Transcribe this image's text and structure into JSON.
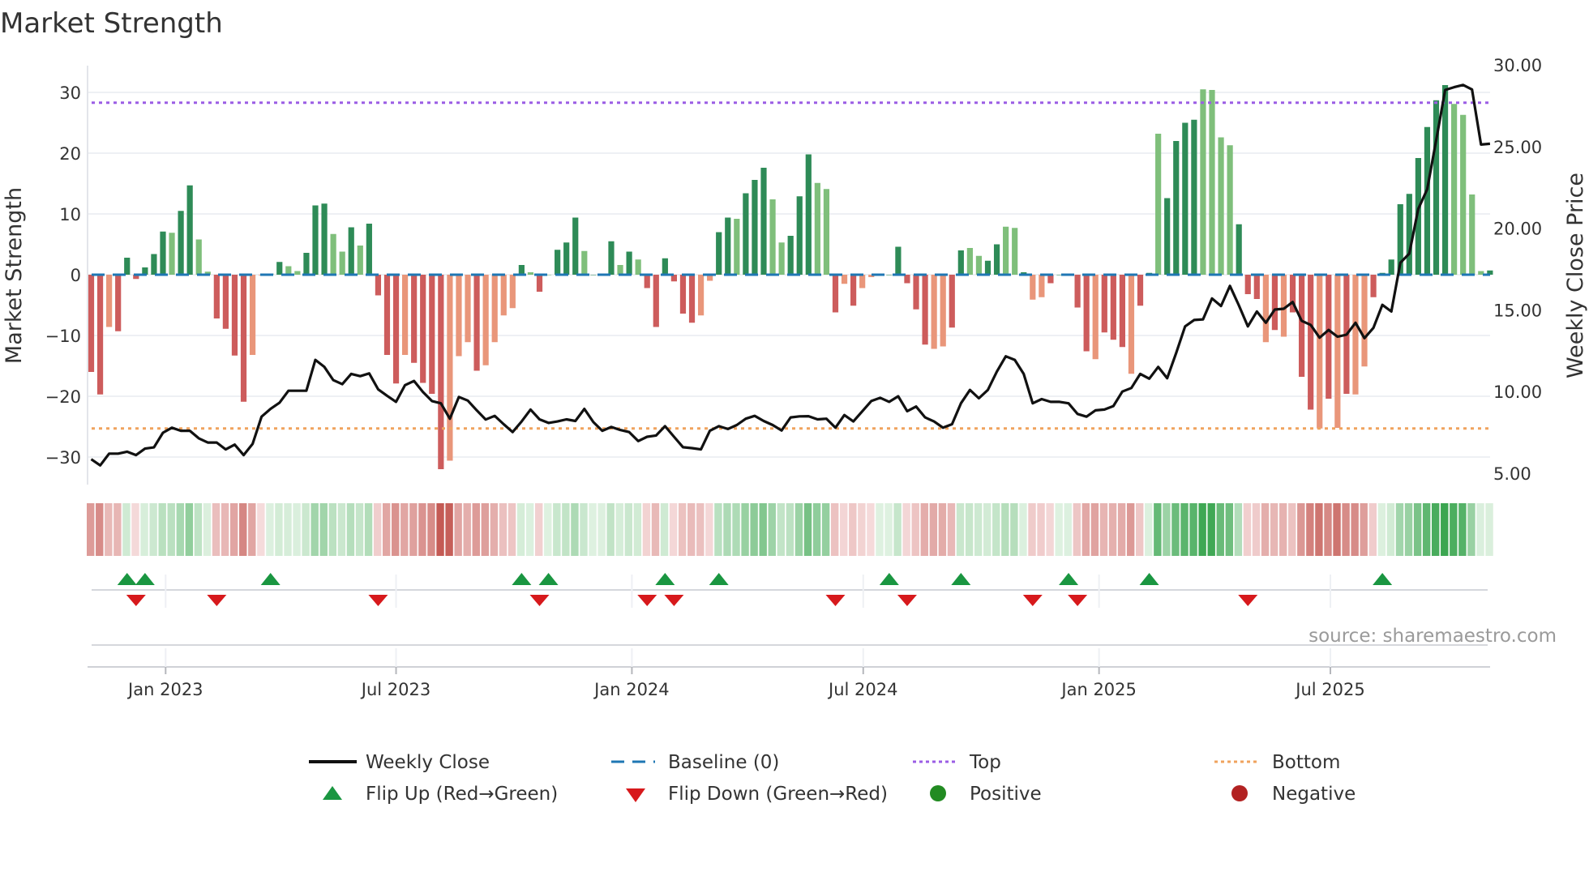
{
  "chart_data": {
    "type": "bar",
    "title": "Market Strength",
    "ylabel": "Market Strength",
    "y2label": "Weekly Close Price",
    "ylim": [
      -33,
      35
    ],
    "y2lim": [
      4.5,
      30.5
    ],
    "yticks": [
      30,
      20,
      10,
      0,
      -10,
      -20,
      -30
    ],
    "ytick_labels": [
      "30",
      "20",
      "10",
      "0",
      "−10",
      "−20",
      "−30"
    ],
    "y2ticks": [
      30,
      25,
      20,
      15,
      10,
      5
    ],
    "y2tick_labels": [
      "30.00",
      "25.00",
      "20.00",
      "15.00",
      "10.00",
      "5.00"
    ],
    "xticks": [
      {
        "label": "Jan 2023",
        "week": 9.3
      },
      {
        "label": "Jul 2023",
        "week": 35.0
      },
      {
        "label": "Jan 2024",
        "week": 61.3
      },
      {
        "label": "Jul 2024",
        "week": 87.1
      },
      {
        "label": "Jan 2025",
        "week": 113.4
      },
      {
        "label": "Jul 2025",
        "week": 139.2
      }
    ],
    "top_level": 28.3,
    "bottom_level": -25.3,
    "baseline": 0,
    "strength": [
      -16,
      -19.7,
      -8.6,
      -9.3,
      2.8,
      -0.7,
      1.2,
      3.4,
      7.1,
      6.9,
      10.5,
      14.7,
      5.8,
      0.5,
      -7.2,
      -8.9,
      -13.3,
      -20.9,
      -13.2,
      -0.1,
      0.2,
      2.1,
      1.4,
      0.6,
      3.6,
      11.4,
      11.7,
      6.7,
      3.8,
      7.8,
      4.8,
      8.4,
      -3.4,
      -13.2,
      -17.9,
      -13.2,
      -14.5,
      -17.8,
      -19.6,
      -32,
      -30.6,
      -13.4,
      -11.1,
      -15.8,
      -14.9,
      -11.1,
      -6.7,
      -5.5,
      1.6,
      0.4,
      -2.8,
      0,
      4.1,
      5.3,
      9.4,
      3.9,
      0,
      0.1,
      5.5,
      1.6,
      3.8,
      2.5,
      -2.2,
      -8.6,
      2.7,
      -1.1,
      -6.4,
      -7.9,
      -6.7,
      -1.0,
      7.0,
      9.4,
      9.2,
      13.4,
      15.6,
      17.6,
      12.4,
      5.3,
      6.4,
      12.9,
      19.8,
      15.1,
      14.1,
      -6.2,
      -1.5,
      -5.1,
      -2.2,
      -0.4,
      0,
      0,
      4.6,
      -1.4,
      -5.7,
      -11.5,
      -12.2,
      -11.8,
      -8.7,
      4.0,
      4.4,
      3.1,
      2.3,
      5.0,
      7.9,
      7.7,
      0.4,
      -4.1,
      -3.7,
      -1.4,
      0,
      0.2,
      -5.4,
      -12.6,
      -13.9,
      -9.5,
      -10.7,
      -11.9,
      -16.3,
      -5.1,
      0.3,
      23.2,
      12.6,
      22.0,
      25.0,
      25.5,
      30.5,
      30.4,
      22.6,
      21.3,
      8.3,
      -3.2,
      -4.0,
      -11.1,
      -9.1,
      -10.2,
      -6.2,
      -16.8,
      -22.2,
      -25.3,
      -20.4,
      -25.2,
      -19.6,
      -19.7,
      -15.1,
      -3.7,
      0.3,
      2.5,
      11.6,
      13.3,
      19.2,
      24.3,
      28.7,
      31.2,
      28.1,
      26.3,
      13.2,
      0.6,
      0.7
    ],
    "shade": "ddlddddddlddllddddllddlldddlldlddddldddd llldlllldldldddldldldlddddddllddldddllddd lldldllddddddllddllddlldlldddddldddlddlddddlllldddldldddldldlldddddddddlllld",
    "weekly_close": [
      5.86,
      5.48,
      6.2,
      6.2,
      6.32,
      6.11,
      6.51,
      6.58,
      7.48,
      7.79,
      7.6,
      7.6,
      7.14,
      6.88,
      6.88,
      6.46,
      6.75,
      6.11,
      6.8,
      8.46,
      8.94,
      9.32,
      10.05,
      10.05,
      10.05,
      11.94,
      11.51,
      10.7,
      10.45,
      11.08,
      10.94,
      11.11,
      10.14,
      9.74,
      9.37,
      10.39,
      10.65,
      9.97,
      9.42,
      9.28,
      8.34,
      9.67,
      9.45,
      8.85,
      8.29,
      8.51,
      8.0,
      7.52,
      8.17,
      8.9,
      8.3,
      8.08,
      8.17,
      8.3,
      8.2,
      8.94,
      8.13,
      7.6,
      7.83,
      7.65,
      7.52,
      6.97,
      7.23,
      7.31,
      7.88,
      7.23,
      6.59,
      6.54,
      6.46,
      7.6,
      7.88,
      7.71,
      7.95,
      8.34,
      8.51,
      8.2,
      7.95,
      7.62,
      8.42,
      8.48,
      8.49,
      8.3,
      8.34,
      7.79,
      8.56,
      8.17,
      8.8,
      9.42,
      9.62,
      9.37,
      9.71,
      8.8,
      9.08,
      8.42,
      8.17,
      7.79,
      8.0,
      9.28,
      10.1,
      9.59,
      10.1,
      11.22,
      12.16,
      11.94,
      11.08,
      9.28,
      9.54,
      9.37,
      9.37,
      9.28,
      8.63,
      8.46,
      8.85,
      8.9,
      9.11,
      10.0,
      10.22,
      11.08,
      10.79,
      11.51,
      10.82,
      12.36,
      13.99,
      14.38,
      14.42,
      15.7,
      15.24,
      16.47,
      15.27,
      13.99,
      14.9,
      14.21,
      15.02,
      15.07,
      15.48,
      14.33,
      14.08,
      13.3,
      13.77,
      13.36,
      13.48,
      14.21,
      13.27,
      13.9,
      15.31,
      14.9,
      17.88,
      18.44,
      21.18,
      22.38,
      25.38,
      28.46,
      28.63,
      28.77,
      28.49,
      25.12,
      25.17
    ],
    "flip_up_weeks": [
      5,
      7,
      21,
      49,
      52,
      65,
      71,
      90,
      98,
      110,
      119,
      145
    ],
    "flip_down_weeks": [
      6,
      15,
      33,
      51,
      63,
      66,
      84,
      92,
      106,
      111,
      130
    ],
    "legend": {
      "weekly_close": "Weekly Close",
      "baseline": "Baseline (0)",
      "top": "Top",
      "bottom": "Bottom",
      "flip_up": "Flip Up (Red→Green)",
      "flip_down": "Flip Down (Green→Red)",
      "positive": "Positive",
      "negative": "Negative"
    },
    "source": "source: sharemaestro.com",
    "colors": {
      "pos_dark": "#2e8b57",
      "pos_light": "#7fbf7b",
      "neg_dark": "#cd5c5c",
      "neg_light": "#e9967a",
      "baseline": "#1f77b4",
      "top": "#9b5de5",
      "bottom": "#f0a35e",
      "line": "#111111",
      "flip_up": "#1a9641",
      "flip_down": "#d7191c",
      "positive": "#228b22",
      "negative": "#b22222"
    }
  }
}
